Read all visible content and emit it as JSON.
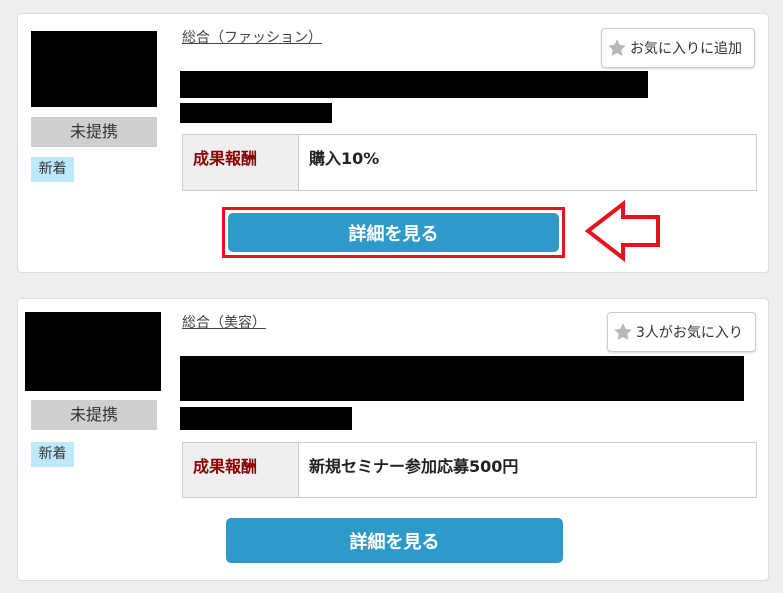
{
  "colors": {
    "accent_button": "#2e9ac9",
    "reward_label": "#8b0000",
    "highlight": "#e5131d",
    "new_badge": "#bde9fb",
    "status_bg": "#cfcfcf"
  },
  "listings": [
    {
      "category": "総合（ファッション）",
      "status": "未提携",
      "badge": "新着",
      "favorite_label": "お気に入りに追加",
      "reward_label": "成果報酬",
      "reward_value": "購入10%",
      "detail_button": "詳細を見る"
    },
    {
      "category": "総合（美容）",
      "status": "未提携",
      "badge": "新着",
      "favorite_label": "3人がお気に入り",
      "reward_label": "成果報酬",
      "reward_value": "新規セミナー参加応募500円",
      "detail_button": "詳細を見る"
    }
  ],
  "annotation": {
    "icon": "left-arrow-icon"
  }
}
